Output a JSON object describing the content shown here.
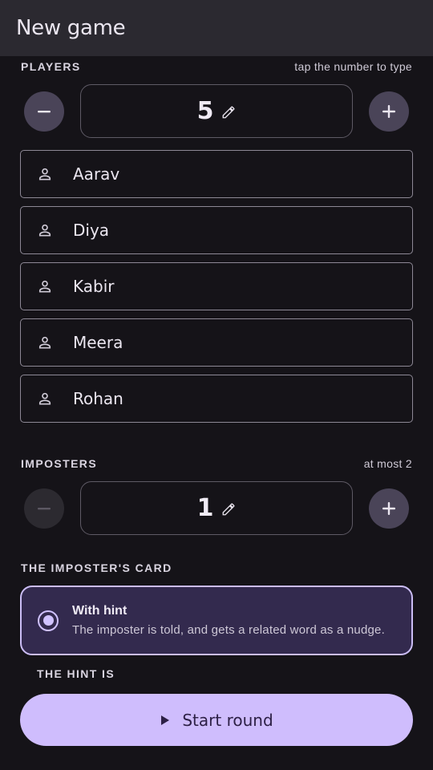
{
  "appbar": {
    "title": "New game"
  },
  "players": {
    "label": "PLAYERS",
    "hint": "tap the number to type",
    "count": "5",
    "names": [
      "Aarav",
      "Diya",
      "Kabir",
      "Meera",
      "Rohan"
    ]
  },
  "imposters": {
    "label": "IMPOSTERS",
    "hint": "at most 2",
    "count": "1",
    "decrement_enabled": false
  },
  "imposter_card": {
    "label": "THE IMPOSTER'S CARD",
    "option_title": "With hint",
    "option_desc": "The imposter is told, and gets a related word as a nudge.",
    "selected": true
  },
  "hint": {
    "label": "THE HINT IS"
  },
  "start": {
    "label": "Start round"
  },
  "icons": {
    "minus": "minus-icon",
    "plus": "plus-icon",
    "edit": "pencil-icon",
    "person": "person-icon",
    "play": "play-icon"
  },
  "colors": {
    "accent": "#cfbdfd",
    "surface": "#151318",
    "appbar": "#2b2930",
    "card_selected": "#332a4e"
  }
}
